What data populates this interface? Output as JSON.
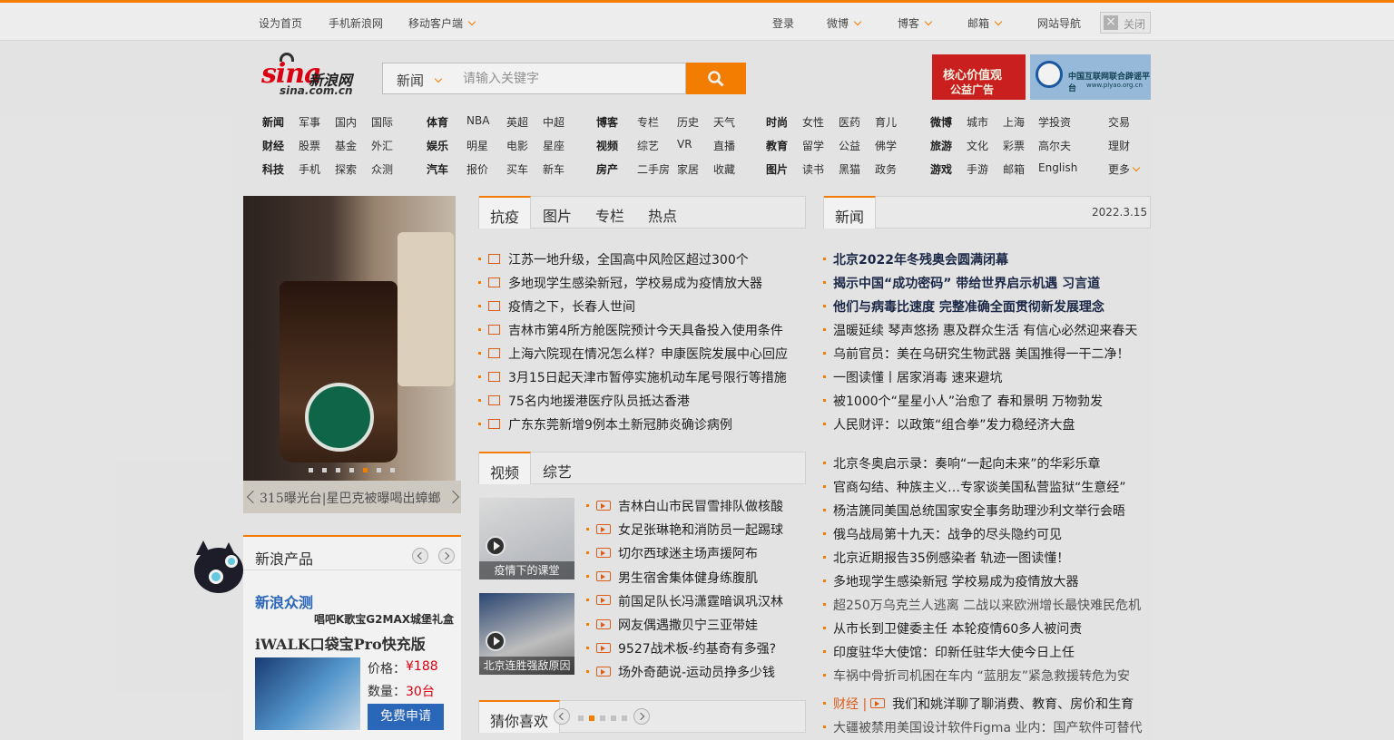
{
  "topbar": {
    "set_home": "设为首页",
    "mobile_sina": "手机新浪网",
    "mobile_client": "移动客户端",
    "login": "登录",
    "weibo": "微博",
    "blog": "博客",
    "mail": "邮箱",
    "site_nav": "网站导航",
    "close": "关闭"
  },
  "logo": {
    "mark": "sina",
    "cn": "新浪网",
    "domain": "sina.com.cn"
  },
  "search": {
    "category": "新闻",
    "placeholder": "请输入关键字"
  },
  "banners": {
    "left_line1": "核心价值观",
    "left_line2": "公益广告",
    "right_title": "中国互联网联合辟谣平台",
    "right_url": "www.piyao.org.cn"
  },
  "nav": {
    "g1": [
      [
        "新闻",
        "军事",
        "国内",
        "国际"
      ],
      [
        "财经",
        "股票",
        "基金",
        "外汇"
      ],
      [
        "科技",
        "手机",
        "探索",
        "众测"
      ]
    ],
    "g2": [
      [
        "体育",
        "NBA",
        "英超",
        "中超"
      ],
      [
        "娱乐",
        "明星",
        "电影",
        "星座"
      ],
      [
        "汽车",
        "报价",
        "买车",
        "新车"
      ]
    ],
    "g3": [
      [
        "博客",
        "专栏",
        "历史",
        "天气"
      ],
      [
        "视频",
        "综艺",
        "VR",
        "直播"
      ],
      [
        "房产",
        "二手房",
        "家居",
        "收藏"
      ]
    ],
    "g4": [
      [
        "时尚",
        "女性",
        "医药",
        "育儿"
      ],
      [
        "教育",
        "留学",
        "公益",
        "佛学"
      ],
      [
        "图片",
        "读书",
        "黑猫",
        "政务"
      ]
    ],
    "g5": [
      [
        "微博",
        "城市",
        "上海",
        "学投资"
      ],
      [
        "旅游",
        "文化",
        "彩票",
        "高尔夫"
      ],
      [
        "游戏",
        "手游",
        "邮箱",
        "English"
      ]
    ],
    "g6": [
      "交易",
      "理财",
      "更多"
    ]
  },
  "slider": {
    "caption": "315曝光台|星巴克被曝喝出蟑螂",
    "dot_count": 7,
    "active_dot": 5
  },
  "center": {
    "tabs": [
      "抗疫",
      "图片",
      "专栏",
      "热点"
    ],
    "news": [
      "江苏一地升级，全国高中风险区超过300个",
      "多地现学生感染新冠，学校易成为疫情放大器",
      "疫情之下，长春人世间",
      "吉林市第4所方舱医院预计今天具备投入使用条件",
      "上海六院现在情况怎么样？申康医院发展中心回应",
      "3月15日起天津市暂停实施机动车尾号限行等措施",
      "75名内地援港医疗队员抵达香港",
      "广东东莞新增9例本土新冠肺炎确诊病例"
    ],
    "video_tabs": [
      "视频",
      "综艺"
    ],
    "thumbs": [
      "疫情下的课堂",
      "北京连胜强敌原因"
    ],
    "videos": [
      "吉林白山市民冒雪排队做核酸",
      "女足张琳艳和消防员一起踢球",
      "切尔西球迷主场声援阿布",
      "男生宿舍集体健身练腹肌",
      "前国足队长冯潇霆暗讽巩汉林",
      "网友偶遇撒贝宁三亚带娃",
      "9527战术板-约基奇有多强?",
      "场外奇葩说-运动员挣多少钱"
    ],
    "guess": "猜你喜欢"
  },
  "right": {
    "tab": "新闻",
    "date": "2022.3.15",
    "headlines": [
      "北京2022年冬残奥会圆满闭幕",
      "揭示中国“成功密码” 带给世界启示机遇 习言道",
      "他们与病毒比速度 完整准确全面贯彻新发展理念"
    ],
    "news1": [
      "温暖延续 琴声悠扬 惠及群众生活 有信心必然迎来春天",
      "乌前官员：美在乌研究生物武器 美国推得一干二净！",
      "一图读懂丨居家消毒 速来避坑",
      "被1000个“星星小人”治愈了 春和景明 万物勃发",
      "人民财评：以政策“组合拳”发力稳经济大盘"
    ],
    "news2": [
      "北京冬奥启示录：奏响“一起向未来”的华彩乐章",
      "官商勾结、种族主义…专家谈美国私营监狱“生意经”",
      "杨洁篪同美国总统国家安全事务助理沙利文举行会晤",
      "俄乌战局第十九天：战争的尽头隐约可见",
      "北京近期报告35例感染者 轨迹一图读懂！",
      "多地现学生感染新冠 学校易成为疫情放大器",
      "超250万乌克兰人逃离 二战以来欧洲增长最快难民危机",
      "从市长到卫健委主任 本轮疫情60多人被问责",
      "印度驻华大使馆：印新任驻华大使今日上任",
      "车祸中骨折司机困在车内 “蓝朋友”紧急救援转危为安"
    ],
    "finance_tag": "财经 |",
    "news3": [
      "我们和姚洋聊了聊消费、教育、房价和生育",
      "大疆被禁用美国设计软件Figma 业内：国产软件可替代"
    ]
  },
  "product": {
    "title": "新浪产品",
    "brand": "新浪众测",
    "promo": "唱吧K歌宝G2MAX城堡礼盒",
    "name": "iWALK口袋宝Pro快充版",
    "price_label": "价格：",
    "price": "¥188",
    "qty_label": "数量：",
    "qty": "30台",
    "apply": "免费申请"
  }
}
